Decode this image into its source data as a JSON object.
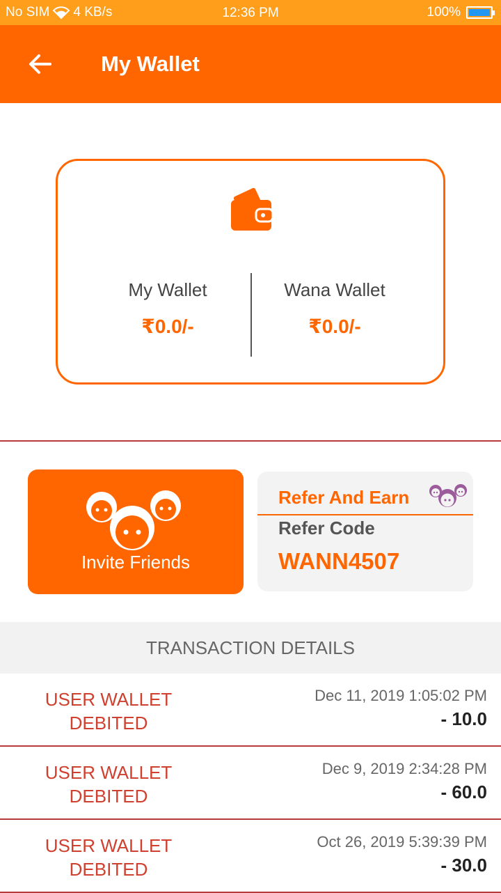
{
  "status_bar": {
    "carrier": "No SIM",
    "speed": "4 KB/s",
    "time": "12:36 PM",
    "battery": "100%",
    "battery_level": 1.0
  },
  "app_bar": {
    "title": "My Wallet",
    "back_icon": "arrow-left-icon"
  },
  "wallet_card": {
    "icon": "wallet-icon",
    "my_wallet_label": "My Wallet",
    "my_wallet_amount": "₹0.0/-",
    "wana_wallet_label": "Wana Wallet",
    "wana_wallet_amount": "₹0.0/-"
  },
  "invite": {
    "label": "Invite Friends",
    "icon": "friends-icon"
  },
  "refer": {
    "title": "Refer And Earn",
    "code_label": "Refer Code",
    "code": "WANN4507",
    "icon": "friends-icon"
  },
  "transactions": {
    "header": "TRANSACTION DETAILS",
    "items": [
      {
        "type_line1": "USER WALLET",
        "type_line2": "DEBITED",
        "date": "Dec 11, 2019 1:05:02 PM",
        "amount": "- 10.0"
      },
      {
        "type_line1": "USER WALLET",
        "type_line2": "DEBITED",
        "date": "Dec 9, 2019 2:34:28 PM",
        "amount": "- 60.0"
      },
      {
        "type_line1": "USER WALLET",
        "type_line2": "DEBITED",
        "date": "Oct 26, 2019 5:39:39 PM",
        "amount": "- 30.0"
      }
    ]
  },
  "colors": {
    "primary": "#FF6600",
    "status_bar": "#FF9E1B",
    "debit_text": "#D0402F",
    "divider": "#B73A3A"
  }
}
